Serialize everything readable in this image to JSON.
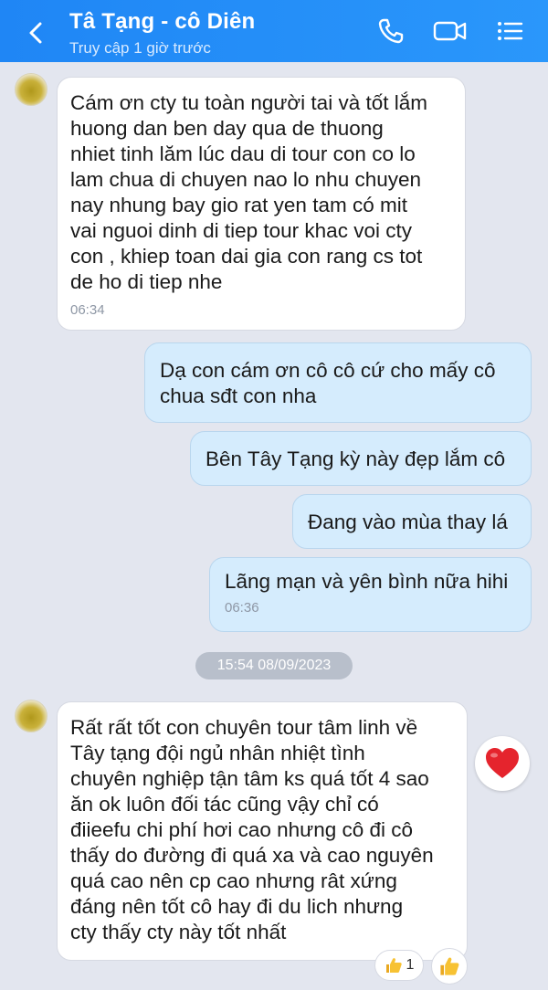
{
  "header": {
    "title": "Tâ Tạng - cô Diên",
    "subtitle": "Truy cập 1 giờ trước",
    "back_icon": "chevron-left-icon",
    "actions": [
      "phone-icon",
      "video-icon",
      "list-icon"
    ]
  },
  "messages": [
    {
      "direction": "in",
      "text": "Cám ơn cty tu toàn người tai và tốt lắm\nhuong dan ben day qua de thuong\nnhiet tinh lăm lúc dau di tour con co lo\nlam chua di chuyen nao lo nhu chuyen\nnay nhung bay gio rat yen tam có mit\nvai nguoi dinh di tiep tour khac voi cty\ncon , khiep toan dai gia con rang cs tot\nde ho di tiep nhe",
      "time": "06:34"
    },
    {
      "direction": "out",
      "text": "Dạ con cám ơn cô cô cứ cho mấy cô\nchua sđt con nha"
    },
    {
      "direction": "out",
      "text": "Bên Tây Tạng kỳ này đẹp lắm cô"
    },
    {
      "direction": "out",
      "text": "Đang vào mùa thay lá"
    },
    {
      "direction": "out",
      "text": "Lãng mạn và yên bình nữa hihi",
      "time": "06:36"
    },
    {
      "direction": "in",
      "text": "Rất rất tốt con chuyên tour tâm linh về\nTây tạng đội ngủ nhân nhiệt tình\nchuyên nghiệp tận tâm ks quá tốt 4 sao\năn ok luôn đối tác cũng vậy chỉ có\nđiieefu chi phí hơi cao nhưng cô đi cô\nthấy do đường đi quá xa và cao nguyên\nquá cao nên cp cao nhưng rât xứng\nđáng nên tốt cô hay đi du lich nhưng\ncty thấy cty này tốt nhất"
    }
  ],
  "date_divider": "15:54 08/09/2023",
  "reactions": {
    "heart_icon": "heart-icon",
    "thumbs_up_count": "1",
    "like_icon": "thumbs-up-icon"
  },
  "colors": {
    "header": "#1f86f5",
    "background": "#e3e6ef",
    "bubble_out": "#d5ecfd",
    "bubble_in": "#ffffff"
  }
}
